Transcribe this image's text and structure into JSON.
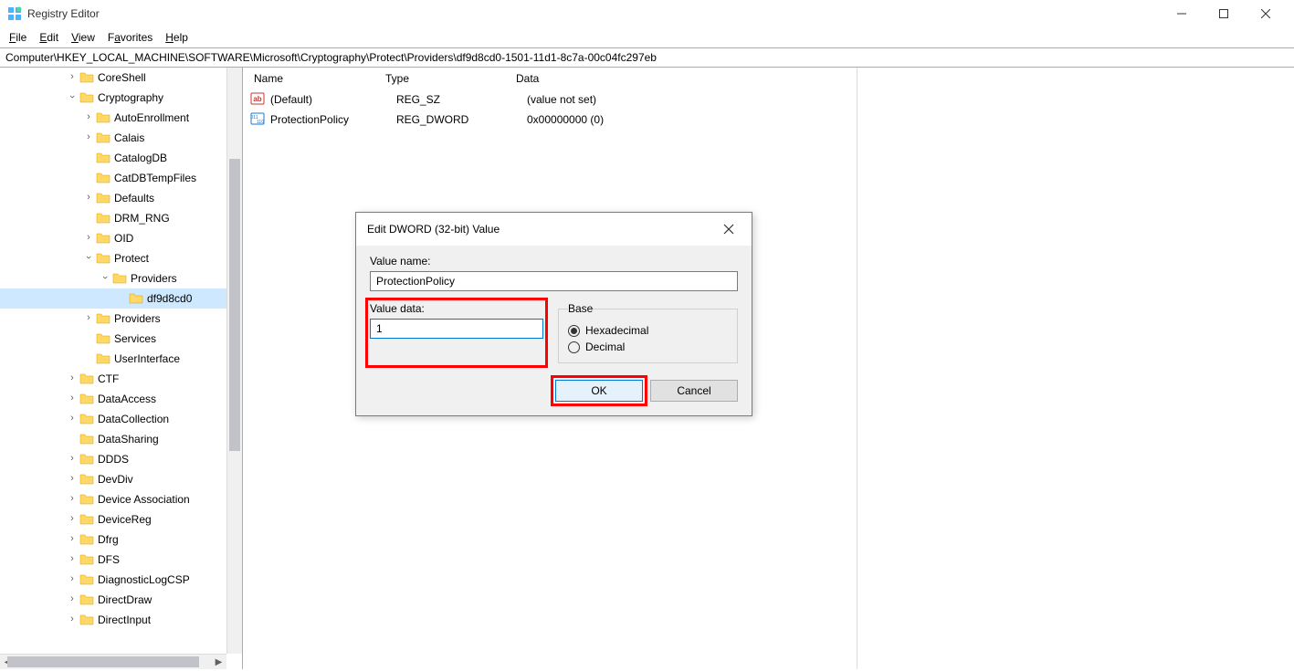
{
  "window": {
    "title": "Registry Editor"
  },
  "menu": {
    "file": "File",
    "edit": "Edit",
    "view": "View",
    "favorites": "Favorites",
    "help": "Help"
  },
  "address": "Computer\\HKEY_LOCAL_MACHINE\\SOFTWARE\\Microsoft\\Cryptography\\Protect\\Providers\\df9d8cd0-1501-11d1-8c7a-00c04fc297eb",
  "tree": [
    {
      "level": 4,
      "expander": ">",
      "label": "CoreShell"
    },
    {
      "level": 4,
      "expander": "v",
      "label": "Cryptography"
    },
    {
      "level": 5,
      "expander": ">",
      "label": "AutoEnrollment"
    },
    {
      "level": 5,
      "expander": ">",
      "label": "Calais"
    },
    {
      "level": 5,
      "expander": "",
      "label": "CatalogDB"
    },
    {
      "level": 5,
      "expander": "",
      "label": "CatDBTempFiles"
    },
    {
      "level": 5,
      "expander": ">",
      "label": "Defaults"
    },
    {
      "level": 5,
      "expander": "",
      "label": "DRM_RNG"
    },
    {
      "level": 5,
      "expander": ">",
      "label": "OID"
    },
    {
      "level": 5,
      "expander": "v",
      "label": "Protect"
    },
    {
      "level": 6,
      "expander": "v",
      "label": "Providers"
    },
    {
      "level": 7,
      "expander": "",
      "label": "df9d8cd0",
      "selected": true
    },
    {
      "level": 5,
      "expander": ">",
      "label": "Providers"
    },
    {
      "level": 5,
      "expander": "",
      "label": "Services"
    },
    {
      "level": 5,
      "expander": "",
      "label": "UserInterface"
    },
    {
      "level": 4,
      "expander": ">",
      "label": "CTF"
    },
    {
      "level": 4,
      "expander": ">",
      "label": "DataAccess"
    },
    {
      "level": 4,
      "expander": ">",
      "label": "DataCollection"
    },
    {
      "level": 4,
      "expander": "",
      "label": "DataSharing"
    },
    {
      "level": 4,
      "expander": ">",
      "label": "DDDS"
    },
    {
      "level": 4,
      "expander": ">",
      "label": "DevDiv"
    },
    {
      "level": 4,
      "expander": ">",
      "label": "Device Association"
    },
    {
      "level": 4,
      "expander": ">",
      "label": "DeviceReg"
    },
    {
      "level": 4,
      "expander": ">",
      "label": "Dfrg"
    },
    {
      "level": 4,
      "expander": ">",
      "label": "DFS"
    },
    {
      "level": 4,
      "expander": ">",
      "label": "DiagnosticLogCSP"
    },
    {
      "level": 4,
      "expander": ">",
      "label": "DirectDraw"
    },
    {
      "level": 4,
      "expander": ">",
      "label": "DirectInput"
    }
  ],
  "list": {
    "headers": {
      "name": "Name",
      "type": "Type",
      "data": "Data"
    },
    "rows": [
      {
        "icon": "string",
        "name": "(Default)",
        "type": "REG_SZ",
        "data": "(value not set)"
      },
      {
        "icon": "binary",
        "name": "ProtectionPolicy",
        "type": "REG_DWORD",
        "data": "0x00000000 (0)"
      }
    ]
  },
  "dialog": {
    "title": "Edit DWORD (32-bit) Value",
    "value_name_label": "Value name:",
    "value_name": "ProtectionPolicy",
    "value_data_label": "Value data:",
    "value_data": "1",
    "base_label": "Base",
    "hex_label": "Hexadecimal",
    "dec_label": "Decimal",
    "ok": "OK",
    "cancel": "Cancel"
  }
}
